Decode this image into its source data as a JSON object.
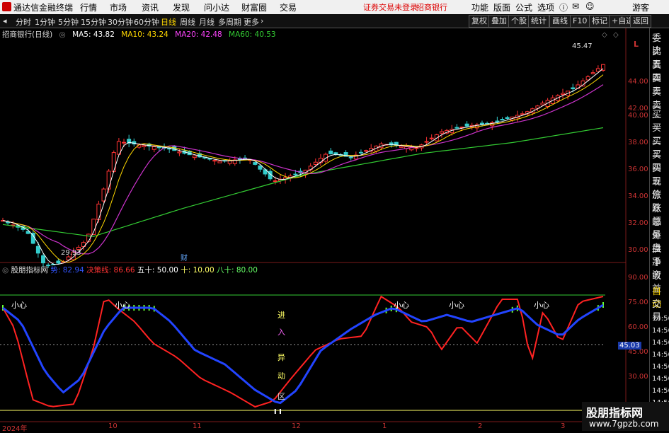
{
  "app": {
    "name": "通达信金融终端",
    "menus": [
      "行情",
      "市场",
      "资讯",
      "发现",
      "问小达",
      "财富圈",
      "交易"
    ],
    "notice": "证券交易未登录",
    "stock_link": "招商银行",
    "right_menus": [
      "功能",
      "版面",
      "公式",
      "选项"
    ],
    "user": "游客"
  },
  "toolbar": {
    "periods": [
      "分时",
      "1分钟",
      "5分钟",
      "15分钟",
      "30分钟",
      "60分钟",
      "日线",
      "周线",
      "月线",
      "多周期",
      "更多"
    ],
    "active_period": "日线",
    "right_buttons": [
      "复权",
      "叠加",
      "个股",
      "统计",
      "画线",
      "F10",
      "标记",
      "+自选",
      "返回"
    ]
  },
  "main_chart": {
    "title": "招商银行(日线)",
    "ma_labels": [
      {
        "label": "MA5: 43.82",
        "color": "#ffffff"
      },
      {
        "label": "MA10: 43.24",
        "color": "#ffd800"
      },
      {
        "label": "MA20: 42.48",
        "color": "#ff44ff"
      },
      {
        "label": "MA60: 40.53",
        "color": "#33cc33"
      }
    ],
    "high_label": "45.47",
    "low_label": "29.93",
    "event_marker": "财",
    "y_axis": [
      "44.00",
      "42.00",
      "40.00",
      "38.00",
      "36.00",
      "34.00",
      "32.00",
      "30.00"
    ],
    "corner": "L"
  },
  "indicator": {
    "title": "股朋指标网",
    "lines": [
      {
        "label": "势: 82.94",
        "color": "#3355ff"
      },
      {
        "label": "决策线: 86.66",
        "color": "#ff3333"
      },
      {
        "label": "五十: 50.00",
        "color": "#ffffff"
      },
      {
        "label": "十: 10.00",
        "color": "#ffff66"
      },
      {
        "label": "八十: 80.00",
        "color": "#66ff66"
      }
    ],
    "caution_label": "小心",
    "vertical_text": [
      "进",
      "入",
      "异",
      "动",
      ""
    ],
    "vertical_text_last": "区",
    "y_axis": [
      "90.00",
      "75.00",
      "60.00",
      "45.00",
      "30.00"
    ],
    "current_value": "45.03"
  },
  "x_axis": [
    "2024年",
    "10",
    "11",
    "12",
    "1",
    "2",
    "3"
  ],
  "sidebar": {
    "items": [
      "委比",
      "卖五",
      "卖四",
      "卖三",
      "卖二",
      "卖一",
      "买一",
      "买二",
      "买三",
      "买四",
      "买五",
      "现价",
      "涨跌",
      "涨幅",
      "总量",
      "外盘",
      "换手",
      "净资",
      "收益",
      "自动",
      "交易"
    ],
    "times": [
      "14:56",
      "14:56",
      "14:56",
      "14:56",
      "14:56",
      "14:56",
      "14:56",
      "14:56",
      "14:56",
      "14:56"
    ]
  },
  "watermark": {
    "title": "股朋指标网",
    "url": "www.7gpzb.com"
  },
  "colors": {
    "up": "#ff3333",
    "down": "#33cccc",
    "ma5": "#ffffff",
    "ma10": "#ffd800",
    "ma20": "#cc33cc",
    "ma60": "#33cc33"
  }
}
